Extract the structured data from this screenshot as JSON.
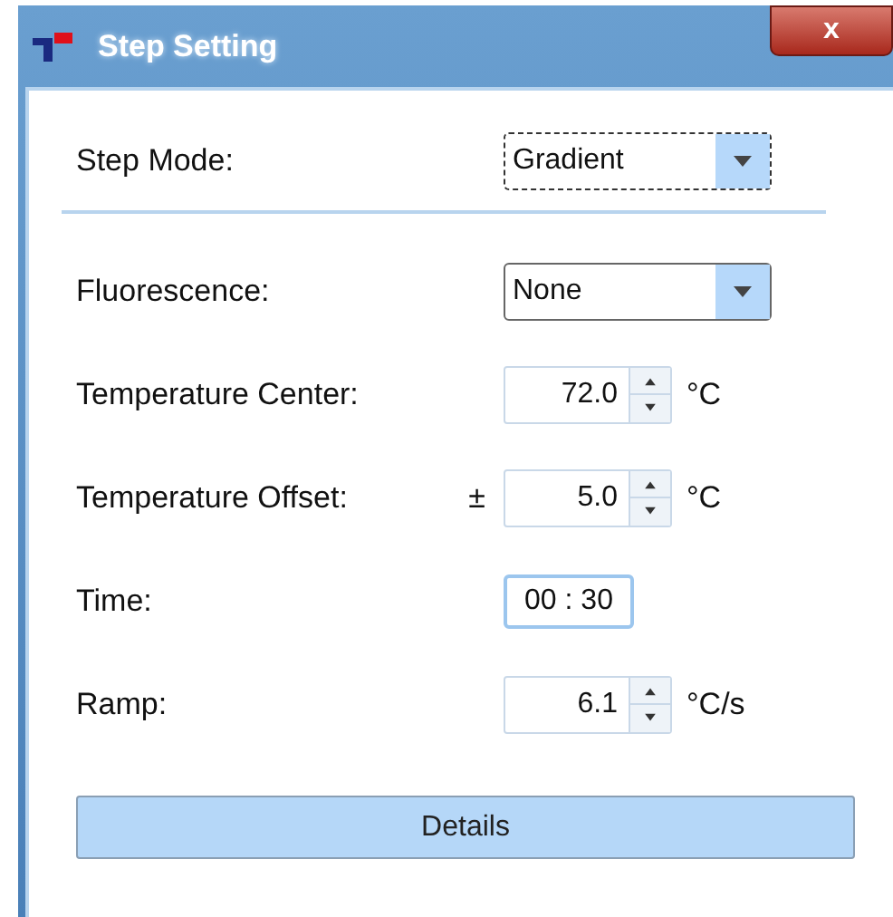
{
  "window": {
    "title": "Step Setting",
    "close": "x"
  },
  "mode": {
    "label": "Step Mode:",
    "value": "Gradient",
    "focused": true
  },
  "fields": [
    {
      "kind": "dropdown",
      "label": "Fluorescence:",
      "value": "None",
      "focused": false
    },
    {
      "kind": "spinner",
      "label": "Temperature Center:",
      "value": "72.0",
      "unit": "°C",
      "focused": false
    },
    {
      "kind": "spinner",
      "label": "Temperature Offset:",
      "prefix": "±",
      "value": "5.0",
      "unit": "°C",
      "focused": false
    },
    {
      "kind": "time",
      "label": "Time:",
      "value": "00 : 30",
      "focused": true
    },
    {
      "kind": "spinner",
      "label": "Ramp:",
      "value": "6.1",
      "unit": "°C/s",
      "focused": false
    }
  ],
  "buttons": [
    "Details"
  ]
}
